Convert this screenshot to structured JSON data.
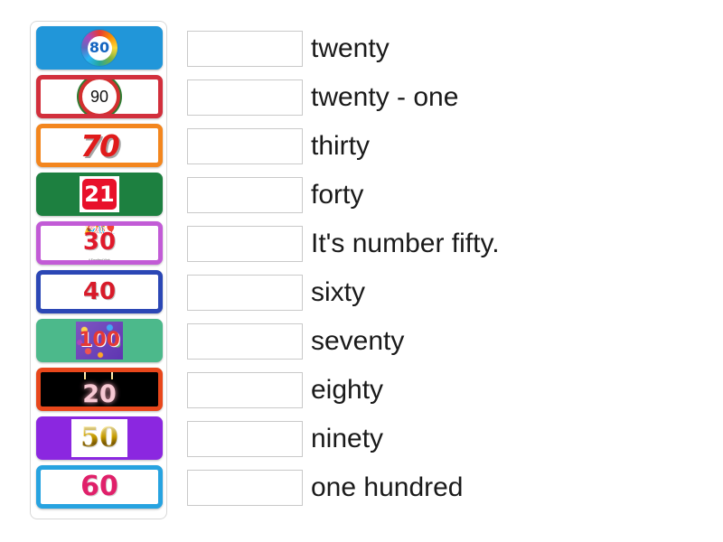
{
  "exercise": {
    "type": "matching-drag-and-drop",
    "background_color": "#ffffff"
  },
  "tile_panel": {
    "name": "number-tiles",
    "tiles": [
      {
        "value": "80",
        "art": "rainbow-ring-badge",
        "style": "solid",
        "fill": "#2196d9",
        "border_color": "#2196d9",
        "text_color": "#1565c0"
      },
      {
        "value": "90",
        "art": "speed-limit-sign",
        "style": "framed",
        "fill": "#ffffff",
        "border_color": "#d22f3c",
        "text_color": "#111111"
      },
      {
        "value": "70",
        "art": "bold-italic-numerals",
        "style": "framed",
        "fill": "#ffffff",
        "border_color": "#f3861e",
        "text_color": "#e01b1b"
      },
      {
        "value": "21",
        "art": "red-chip-card",
        "style": "solid",
        "fill": "#1d8040",
        "border_color": "#1d8040",
        "text_color": "#ffffff"
      },
      {
        "value": "30",
        "art": "confetti-numerals",
        "style": "framed",
        "fill": "#ffffff",
        "border_color": "#c25bd6",
        "text_color": "#e0192b"
      },
      {
        "value": "40",
        "art": "plain-numerals",
        "style": "framed",
        "fill": "#ffffff",
        "border_color": "#2b47b5",
        "text_color": "#d81b2a"
      },
      {
        "value": "100",
        "art": "confetti-card",
        "style": "solid",
        "fill": "#4cb98b",
        "border_color": "#4cb98b",
        "text_color": "#e53935"
      },
      {
        "value": "20",
        "art": "birthday-candle-numerals",
        "style": "framed-black",
        "fill": "#000000",
        "border_color": "#e8471b",
        "text_color": "#f7c9d4"
      },
      {
        "value": "50",
        "art": "gold-numerals-card",
        "style": "solid",
        "fill": "#8b27e0",
        "border_color": "#8b27e0",
        "text_color": "#e0b000"
      },
      {
        "value": "60",
        "art": "magenta-numerals",
        "style": "framed",
        "fill": "#ffffff",
        "border_color": "#27a3e0",
        "text_color": "#e0206a"
      }
    ],
    "tile_30_caption": "A Excellent Work"
  },
  "answers": {
    "drop_zone_placeholder": "",
    "rows": [
      {
        "label": "twenty"
      },
      {
        "label": "twenty - one"
      },
      {
        "label": "thirty"
      },
      {
        "label": "forty"
      },
      {
        "label": "It's number fifty."
      },
      {
        "label": "sixty"
      },
      {
        "label": "seventy"
      },
      {
        "label": "eighty"
      },
      {
        "label": "ninety"
      },
      {
        "label": "one hundred"
      }
    ]
  }
}
